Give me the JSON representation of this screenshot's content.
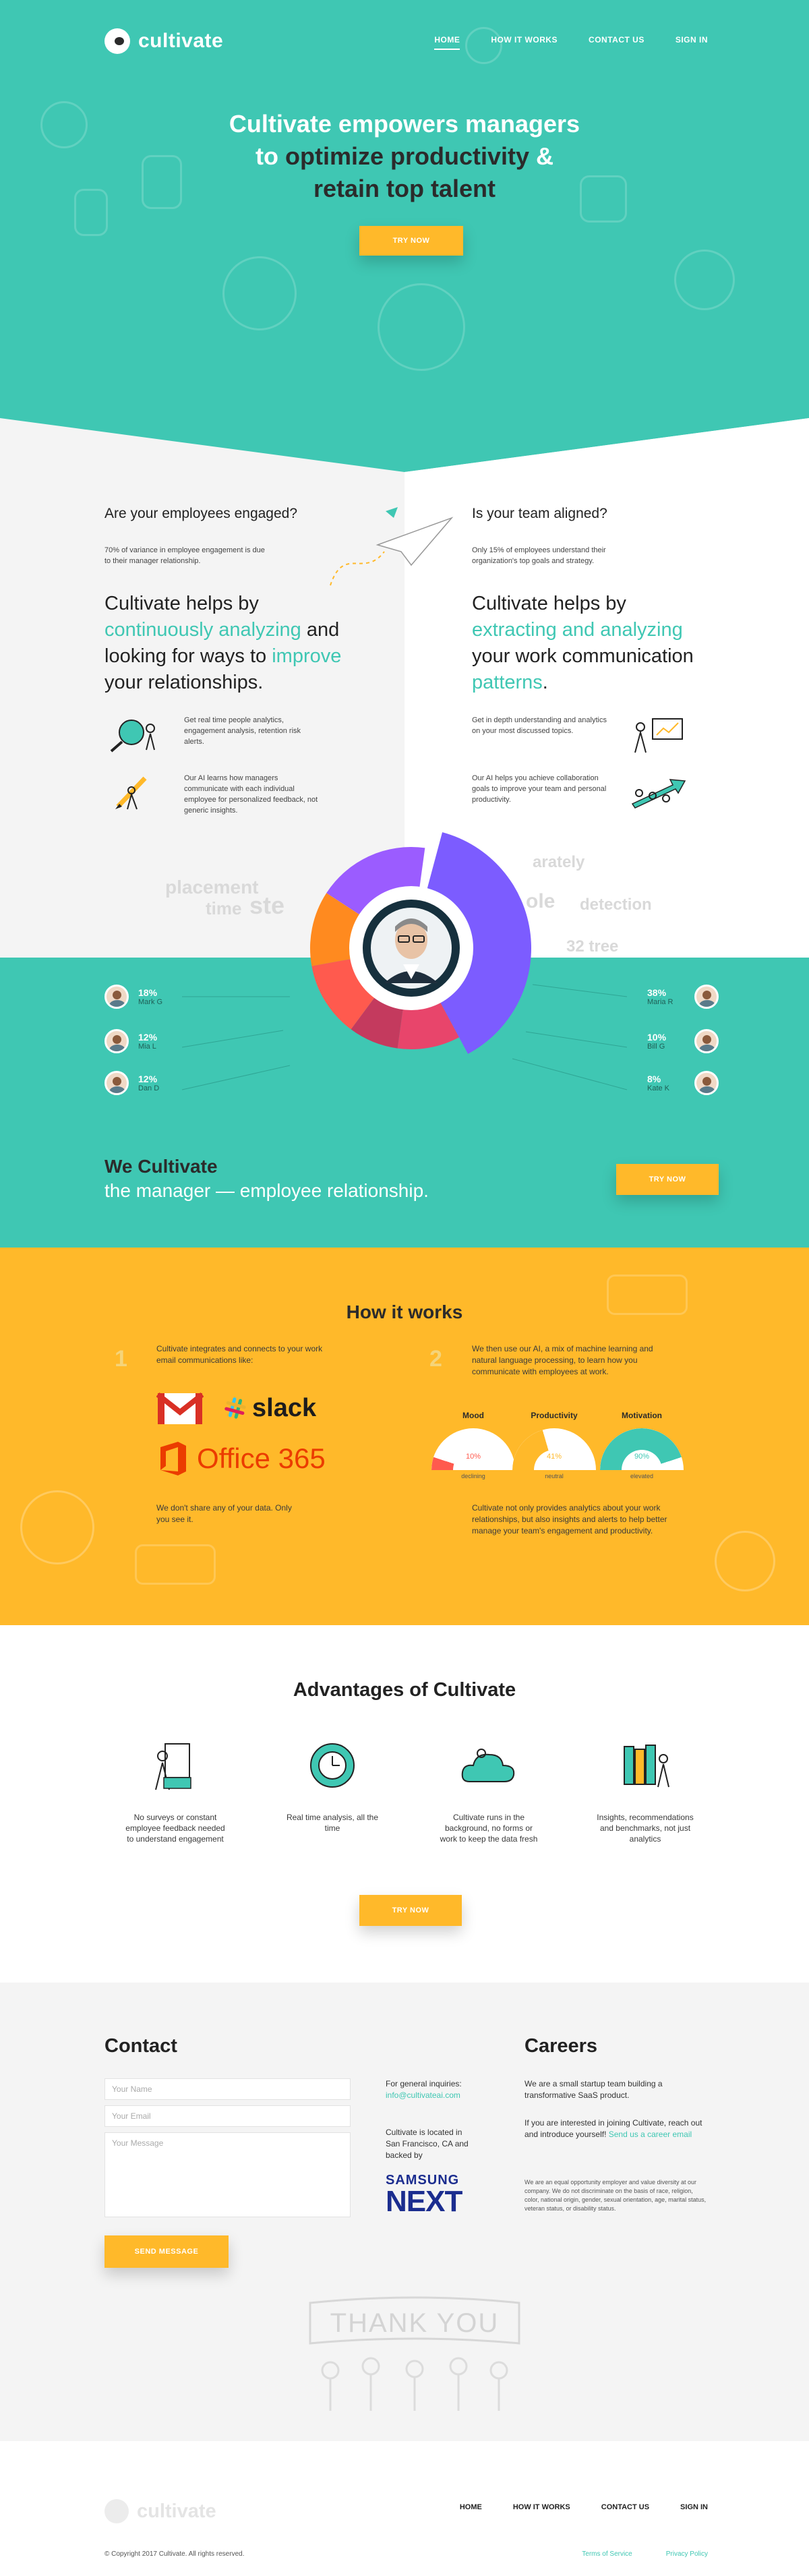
{
  "brand": {
    "name": "cultivate",
    "accent": "#3fc7b3",
    "accent_alt": "#ffb92a",
    "dark": "#2b2b2b"
  },
  "nav": {
    "items": [
      "HOME",
      "HOW IT WORKS",
      "CONTACT US",
      "SIGN IN"
    ],
    "active": "HOME"
  },
  "hero": {
    "line1": "Cultivate empowers managers",
    "line2_pre": "to",
    "line2_hl": "optimize productivity",
    "line2_post": "&",
    "line3": "retain top talent",
    "cta": "TRY NOW"
  },
  "features": {
    "left": {
      "question": "Are your employees engaged?",
      "note": "70% of variance in employee engagement is due to their manager relationship.",
      "big_pre": "Cultivate helps by",
      "big_hl1": "continuously analyzing",
      "big_mid": "and looking for ways to",
      "big_hl2": "improve",
      "big_post": "your relationships.",
      "items": [
        {
          "icon": "magnifier-people-icon",
          "text": "Get real time people analytics, engagement analysis, retention risk alerts."
        },
        {
          "icon": "pencil-person-icon",
          "text": "Our AI learns how managers communicate with each individual employee for personalized feedback, not generic insights."
        }
      ]
    },
    "right": {
      "question": "Is your team aligned?",
      "note": "Only 15% of employees understand their organization's top goals and strategy.",
      "big_pre": "Cultivate helps by",
      "big_hl1": "extracting and analyzing",
      "big_mid": "your work communication",
      "big_hl2": "patterns",
      "big_post": ".",
      "items": [
        {
          "icon": "presentation-board-icon",
          "text": "Get in depth understanding and analytics on your most discussed topics."
        },
        {
          "icon": "team-arrow-icon",
          "text": "Our AI helps you achieve collaboration goals to improve your team and personal productivity."
        }
      ]
    }
  },
  "stats": {
    "people_left": [
      {
        "pct": "18%",
        "name": "Mark G"
      },
      {
        "pct": "12%",
        "name": "Mia L"
      },
      {
        "pct": "12%",
        "name": "Dan D"
      }
    ],
    "people_right": [
      {
        "pct": "38%",
        "name": "Maria R"
      },
      {
        "pct": "10%",
        "name": "Bill G"
      },
      {
        "pct": "8%",
        "name": "Kate K"
      }
    ],
    "headline1": "We Cultivate",
    "headline2": "the manager — employee relationship.",
    "cta": "TRY NOW",
    "donut_colors": [
      "#7c5cff",
      "#3f6bff",
      "#ff5a4e",
      "#ff8a1f",
      "#e8456b",
      "#c43a5e",
      "#b06dff"
    ]
  },
  "how": {
    "title": "How it works",
    "step1": {
      "num": "1",
      "text": "Cultivate integrates and connects to your work email communications like:",
      "note": "We don't share any of your data. Only you see it."
    },
    "logos": {
      "gmail": "Gmail",
      "slack": "slack",
      "office": "Office 365"
    },
    "step2": {
      "num": "2",
      "text": "We then use our AI, a mix of machine learning and natural language processing, to learn how you communicate with employees at work.",
      "note": "Cultivate not only provides analytics about your work relationships, but also insights and alerts to help better manage your team's engagement and productivity."
    },
    "gauges": [
      {
        "label": "Mood",
        "value": "10%",
        "tag": "declining",
        "level": 0.1
      },
      {
        "label": "Productivity",
        "value": "41%",
        "tag": "neutral",
        "level": 0.41
      },
      {
        "label": "Motivation",
        "value": "90%",
        "tag": "elevated",
        "level": 0.9
      }
    ]
  },
  "advantages": {
    "title": "Advantages of Cultivate",
    "items": [
      {
        "icon": "paper-person-icon",
        "text": "No surveys or constant employee feedback needed to understand engagement"
      },
      {
        "icon": "clock-person-icon",
        "text": "Real time analysis, all the time"
      },
      {
        "icon": "cloud-person-icon",
        "text": "Cultivate runs in the background, no forms or work to keep the data fresh"
      },
      {
        "icon": "books-icon",
        "text": "Insights, recommendations and benchmarks, not just analytics"
      }
    ],
    "cta": "TRY NOW"
  },
  "contact": {
    "title": "Contact",
    "name_placeholder": "Your Name",
    "email_placeholder": "Your Email",
    "message_placeholder": "Your Message",
    "send": "SEND MESSAGE",
    "inquiries_label": "For general inquiries:",
    "inquiries_email": "info@cultivateai.com",
    "location": "Cultivate is located in San Francisco, CA and backed by",
    "backer1": "SAMSUNG",
    "backer2": "NEXT"
  },
  "careers": {
    "title": "Careers",
    "p1": "We are a small startup team building a transformative SaaS product.",
    "p2": "If you are interested in joining Cultivate, reach out and introduce yourself!",
    "p2_link": "Send us a career email",
    "legal": "We are an equal opportunity employer and value diversity at our company. We do not discriminate on the basis of race, religion, color, national origin, gender, sexual orientation, age, marital status, veteran status, or disability status."
  },
  "thankyou": "THANK YOU",
  "footer": {
    "brand": "cultivate",
    "nav": [
      "HOME",
      "HOW IT WORKS",
      "CONTACT US",
      "SIGN IN"
    ],
    "copyright": "© Copyright 2017 Cultivate. All rights reserved.",
    "links": [
      "Terms of Service",
      "Privacy Policy"
    ]
  }
}
